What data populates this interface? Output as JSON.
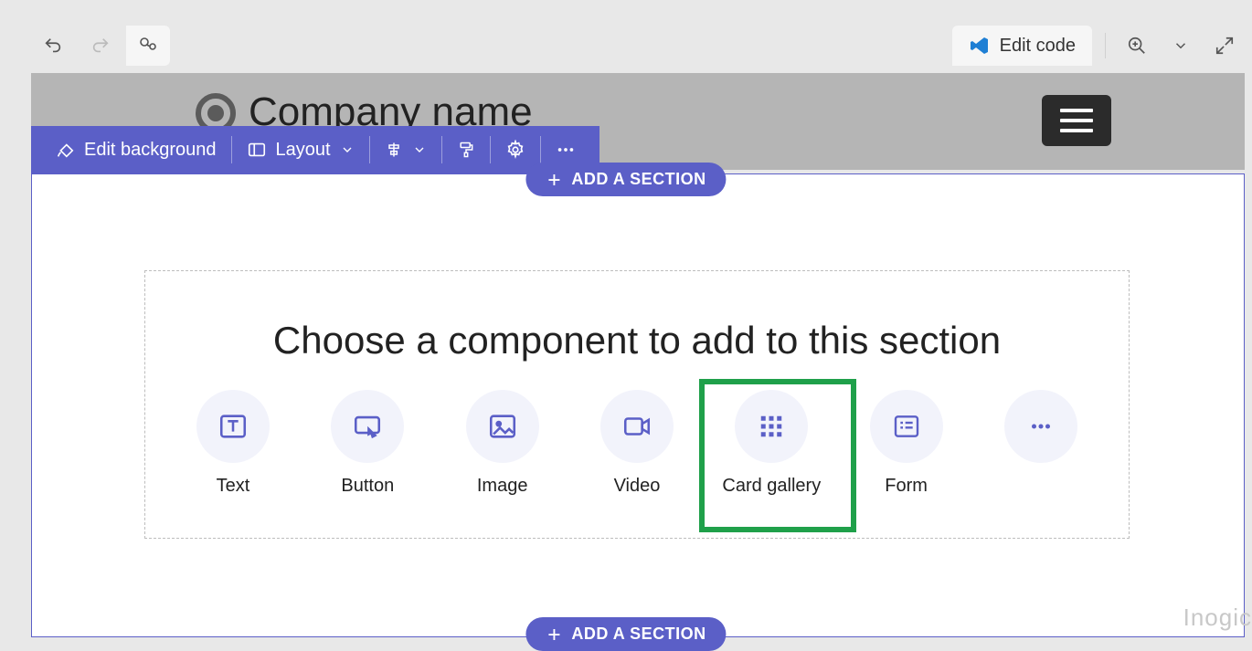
{
  "toolbar": {
    "edit_code_label": "Edit code"
  },
  "banner": {
    "company_name": "Company name"
  },
  "edit_toolbar": {
    "bg_label": "Edit background",
    "layout_label": "Layout"
  },
  "section": {
    "add_top": "ADD A SECTION",
    "add_bottom": "ADD A SECTION"
  },
  "picker": {
    "title": "Choose a component to add to this section",
    "components": [
      {
        "label": "Text"
      },
      {
        "label": "Button"
      },
      {
        "label": "Image"
      },
      {
        "label": "Video"
      },
      {
        "label": "Card gallery"
      },
      {
        "label": "Form"
      },
      {
        "label": ""
      }
    ]
  },
  "watermark": "Inogic"
}
